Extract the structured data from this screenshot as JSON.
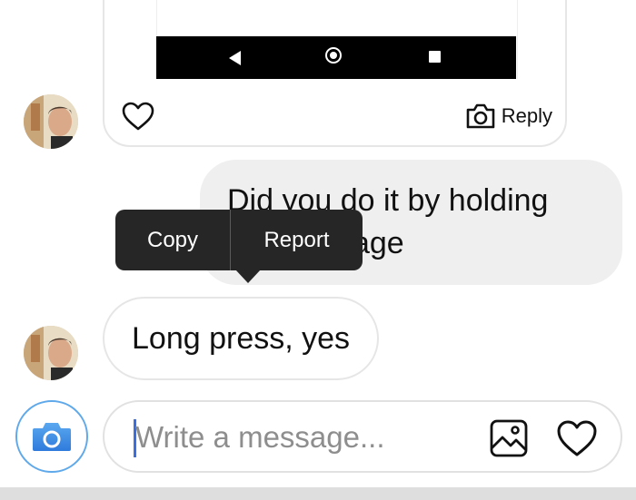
{
  "shared_post": {
    "reply_label": "Reply",
    "icons": {
      "like": "heart-outline-icon",
      "reply": "camera-outline-icon",
      "nav_back": "triangle-back-icon",
      "nav_home": "circle-home-icon",
      "nav_recent": "square-recents-icon"
    }
  },
  "messages": [
    {
      "direction": "outgoing",
      "text": "Did you do it by holding the message"
    },
    {
      "direction": "incoming",
      "text": "Long press, yes"
    }
  ],
  "context_menu": {
    "items": [
      {
        "label": "Copy"
      },
      {
        "label": "Report"
      }
    ]
  },
  "composer": {
    "placeholder": "Write a message...",
    "value": "",
    "icons": {
      "camera": "camera-icon",
      "gallery": "image-icon",
      "like": "heart-outline-icon"
    }
  },
  "colors": {
    "accent": "#3f8fe6",
    "outgoing_bubble": "#efefef",
    "context_menu_bg": "#262626"
  }
}
